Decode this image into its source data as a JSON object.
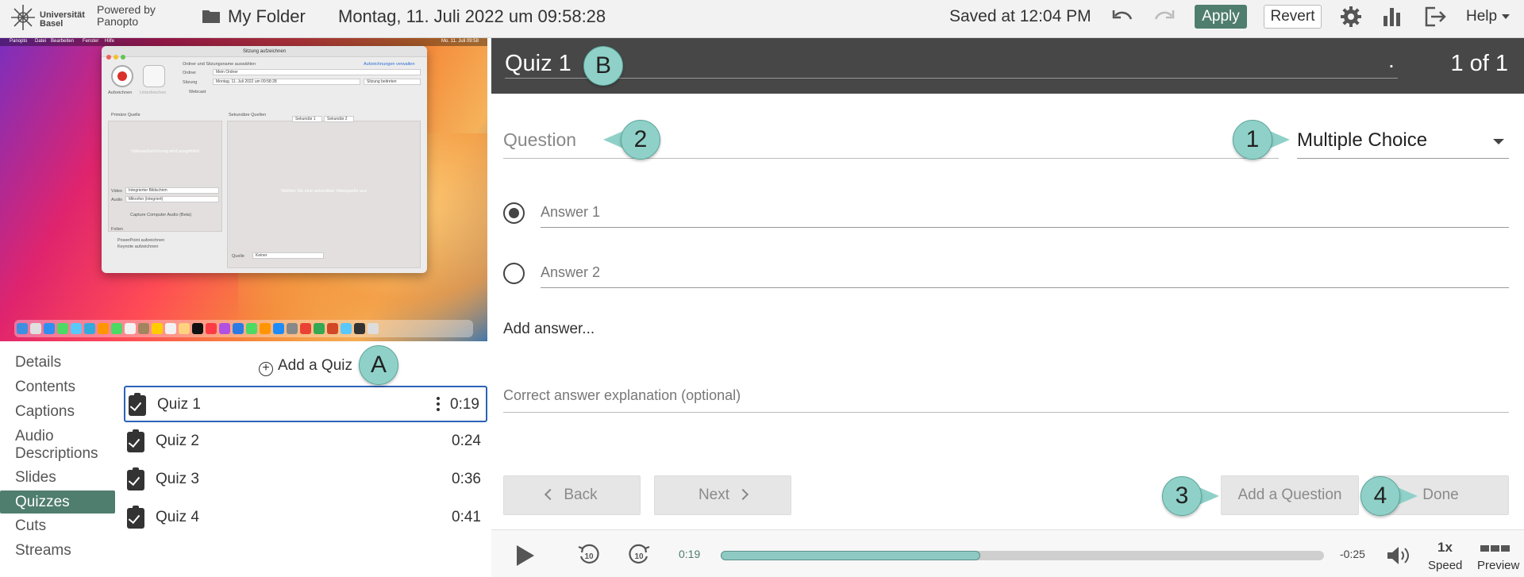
{
  "topbar": {
    "university": "Universität\nBasel",
    "powered_by": "Powered by\nPanopto",
    "folder_name": "My Folder",
    "session_name": "Montag, 11. Juli 2022 um 09:58:28",
    "saved_status": "Saved at 12:04 PM",
    "apply_label": "Apply",
    "revert_label": "Revert",
    "help_label": "Help",
    "accent_color": "#4f7d6e"
  },
  "video": {
    "window_title": "Sitzung aufzeichnen",
    "record_label": "Aufzeichnen",
    "pause_label": "Unterbrechen",
    "folder_heading": "Ordner und Sitzungsname auswählen",
    "manage_link": "Aufzeichnungen verwalten",
    "folder_label": "Ordner",
    "folder_value": "Mein Ordner",
    "session_label": "Sitzung",
    "session_value": "Montag, 11. Juli 2022 um 09:58:28",
    "join_session": "Sitzung beitreten",
    "webcast": "Webcast",
    "primary_source": "Primäre Quelle",
    "secondary_sources": "Sekundäre Quellen",
    "secondary_tab_1": "Sekundär 1",
    "secondary_tab_2": "Sekundär 2",
    "no_video_primary": "Videoaufzeichnung wird ausgeführt",
    "no_video_secondary": "Wählen Sie eine sekundäre Videoquelle aus",
    "video_label": "Video",
    "video_value": "Integrierter Bildschirm",
    "audio_label": "Audio",
    "audio_value": "Mikrofon (integriert)",
    "capture_audio": "Capture Computer Audio (Beta)",
    "slides_label": "Folien",
    "ppt_label": "PowerPoint aufzeichnen",
    "keynote_label": "Keynote aufzeichnen",
    "source_label": "Quelle",
    "source_value": "Keiner",
    "menubar": [
      "Panopto",
      "Datei",
      "Bearbeiten",
      "Fenster",
      "Hilfe"
    ],
    "clock": "Mo. 11. Juli 09:58"
  },
  "nav": {
    "items": [
      {
        "label": "Details"
      },
      {
        "label": "Contents"
      },
      {
        "label": "Captions"
      },
      {
        "label": "Audio Descriptions"
      },
      {
        "label": "Slides"
      },
      {
        "label": "Quizzes"
      },
      {
        "label": "Cuts"
      },
      {
        "label": "Streams"
      }
    ],
    "active": "Quizzes"
  },
  "quizzes": {
    "add_label": "Add a Quiz",
    "items": [
      {
        "name": "Quiz 1",
        "time": "0:19"
      },
      {
        "name": "Quiz 2",
        "time": "0:24"
      },
      {
        "name": "Quiz 3",
        "time": "0:36"
      },
      {
        "name": "Quiz 4",
        "time": "0:41"
      }
    ]
  },
  "editor": {
    "quiz_title": "Quiz 1",
    "title_suffix": ".",
    "counter": "1 of 1",
    "question_placeholder": "Question",
    "question_type": "Multiple Choice",
    "answers": [
      {
        "placeholder": "Answer 1",
        "checked": true
      },
      {
        "placeholder": "Answer 2",
        "checked": false
      }
    ],
    "add_answer": "Add answer...",
    "explanation_placeholder": "Correct answer explanation (optional)",
    "back_label": "Back",
    "next_label": "Next",
    "add_question_label": "Add a Question",
    "done_label": "Done"
  },
  "playback": {
    "current_time": "0:19",
    "remaining_time": "-0:25",
    "progress": 0.43,
    "speed_value": "1x",
    "speed_label": "Speed",
    "preview_label": "Preview",
    "rewind_seconds": "10",
    "forward_seconds": "10"
  },
  "callouts": {
    "a": "A",
    "b": "B",
    "one": "1",
    "two": "2",
    "three": "3",
    "four": "4",
    "color": "#8fd1c8"
  }
}
